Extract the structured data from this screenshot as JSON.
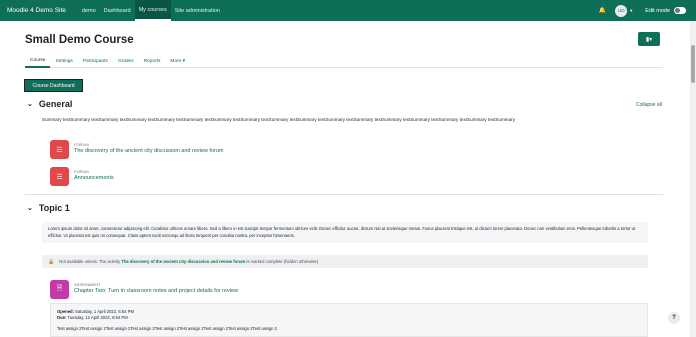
{
  "navbar": {
    "site_name": "Moodle 4 Demo Site",
    "links": [
      "demo",
      "Dashboard",
      "My courses",
      "Site administration"
    ],
    "bell_icon": "bell-icon",
    "avatar_initials": "UO",
    "edit_mode_label": "Edit mode"
  },
  "course": {
    "title": "Small Demo Course",
    "tabs": [
      "Course",
      "Settings",
      "Participants",
      "Grades",
      "Reports",
      "More ▾"
    ],
    "dashboard_button": "Course Dashboard",
    "collapse_all": "Collapse all"
  },
  "general": {
    "title": "General",
    "summary": "Summary textSummary textSummary textSummary textSummary textSummary textSummary textSummary textSummary textSummary textSummary textSummary textSummary textSummary textSummary textSummary textSummary",
    "activities": [
      {
        "type": "FORUM",
        "name": "The discovery of the ancient city discussion and review forum"
      },
      {
        "type": "FORUM",
        "name": "Announcements"
      }
    ]
  },
  "topic1": {
    "title": "Topic 1",
    "description": "Lorem ipsum dolor sit amet, consectetur adipiscing elit. Curabitur ultrices ornare libero. Sed a libero in est suscipit tempor fermentum ultrices velit. Donec efficitur auctor, dictum nisi at scelerisque metus. Fusce placerat tristique est, ut dictum lorem placerata. Donec non vestibulum eros. Pellentesque lobortis a tortor ut efficitur. Ut placerat est quis mi consequat. Class aptent taciti sociosqu ad litora torquent per conubia nostra, per inceptos himenaeos.",
    "restriction_prefix": "Not available unless: The activity",
    "restriction_link": "The discovery of the ancient city discussion and review forum",
    "restriction_suffix": "is marked complete (hidden otherwise)",
    "assignment_type": "ASSIGNMENT",
    "assignment_name": "Chapter Two: Turn in classroom notes and project details for review",
    "opened_label": "Opened:",
    "opened_value": "Saturday, 1 April 2022, 6:54 PM",
    "due_label": "Due:",
    "due_value": "Tuesday, 12 April 2022, 6:54 PM",
    "assign_text": "Test assign 2Test assign 2Test assign 2Test assign 2Test assign 2Test assign 2Test assign 2Test assign 2Test assign 2"
  },
  "help_label": "?",
  "colors": {
    "brand": "#0f6e57",
    "forum": "#e0484c",
    "assignment": "#c339a8"
  }
}
